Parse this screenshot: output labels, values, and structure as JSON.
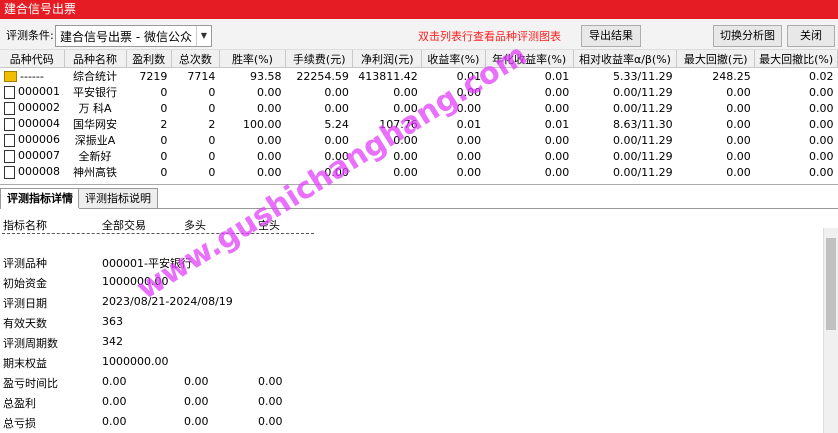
{
  "window": {
    "title": "建合信号出票"
  },
  "toolbar": {
    "condition_label": "评测条件:",
    "condition_value": "建合信号出票  -  微信公众",
    "hint": "双击列表行查看品种评测图表",
    "export_label": "导出结果",
    "switch_label": "切换分析图",
    "close_label": "关闭"
  },
  "table": {
    "headers": [
      "品种代码",
      "品种名称",
      "盈利数",
      "总次数",
      "胜率(%)",
      "手续费(元)",
      "净利润(元)",
      "收益率(%)",
      "年化收益率(%)",
      "相对收益率α/β(%)",
      "最大回撤(元)",
      "最大回撤比(%)"
    ],
    "rows": [
      {
        "icon": "folder-icon",
        "code": "------",
        "name": "综合统计",
        "win": "7219",
        "total": "7714",
        "rate": "93.58",
        "fee": "22254.59",
        "profit": "413811.42",
        "ret": "0.01",
        "annual": "0.01",
        "relative": "5.33/11.29",
        "dd": "248.25",
        "ddr": "0.02"
      },
      {
        "icon": "document-icon",
        "code": "000001",
        "name": "平安银行",
        "win": "0",
        "total": "0",
        "rate": "0.00",
        "fee": "0.00",
        "profit": "0.00",
        "ret": "0.00",
        "annual": "0.00",
        "relative": "0.00/11.29",
        "dd": "0.00",
        "ddr": "0.00"
      },
      {
        "icon": "document-icon",
        "code": "000002",
        "name": "万 科A",
        "win": "0",
        "total": "0",
        "rate": "0.00",
        "fee": "0.00",
        "profit": "0.00",
        "ret": "0.00",
        "annual": "0.00",
        "relative": "0.00/11.29",
        "dd": "0.00",
        "ddr": "0.00"
      },
      {
        "icon": "document-icon",
        "code": "000004",
        "name": "国华网安",
        "win": "2",
        "total": "2",
        "rate": "100.00",
        "fee": "5.24",
        "profit": "107.76",
        "ret": "0.01",
        "annual": "0.01",
        "relative": "8.63/11.30",
        "dd": "0.00",
        "ddr": "0.00"
      },
      {
        "icon": "document-icon",
        "code": "000006",
        "name": "深振业A",
        "win": "0",
        "total": "0",
        "rate": "0.00",
        "fee": "0.00",
        "profit": "0.00",
        "ret": "0.00",
        "annual": "0.00",
        "relative": "0.00/11.29",
        "dd": "0.00",
        "ddr": "0.00"
      },
      {
        "icon": "document-icon",
        "code": "000007",
        "name": "全新好",
        "win": "0",
        "total": "0",
        "rate": "0.00",
        "fee": "0.00",
        "profit": "0.00",
        "ret": "0.00",
        "annual": "0.00",
        "relative": "0.00/11.29",
        "dd": "0.00",
        "ddr": "0.00"
      },
      {
        "icon": "document-icon",
        "code": "000008",
        "name": "神州高铁",
        "win": "0",
        "total": "0",
        "rate": "0.00",
        "fee": "0.00",
        "profit": "0.00",
        "ret": "0.00",
        "annual": "0.00",
        "relative": "0.00/11.29",
        "dd": "0.00",
        "ddr": "0.00"
      }
    ]
  },
  "tabs": [
    "评测指标详情",
    "评测指标说明"
  ],
  "detail": {
    "headers": [
      "指标名称",
      "全部交易",
      "多头",
      "空头"
    ],
    "rows": [
      {
        "label": "评测品种",
        "values": [
          "000001-平安银行"
        ]
      },
      {
        "label": "初始资金",
        "values": [
          "1000000.00"
        ]
      },
      {
        "label": "评测日期",
        "values": [
          "2023/08/21-2024/08/19"
        ]
      },
      {
        "label": "有效天数",
        "values": [
          "363"
        ]
      },
      {
        "label": "评测周期数",
        "values": [
          "342"
        ]
      },
      {
        "label": "期末权益",
        "values": [
          "1000000.00"
        ]
      },
      {
        "label": "盈亏时间比",
        "values": [
          "0.00",
          "0.00",
          "0.00"
        ]
      },
      {
        "label": "总盈利",
        "values": [
          "0.00",
          "0.00",
          "0.00"
        ]
      },
      {
        "label": "总亏损",
        "values": [
          "0.00",
          "0.00",
          "0.00"
        ]
      }
    ]
  },
  "watermark": "www.gushichanghang.com",
  "colors": {
    "title_bar": "#e51c23",
    "hint": "#ff1e1e",
    "watermark": "#e040fb"
  }
}
